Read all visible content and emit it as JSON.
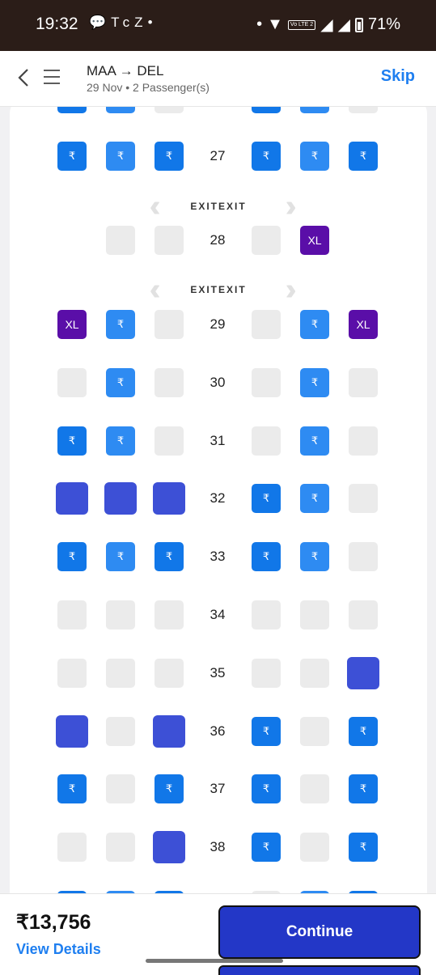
{
  "status": {
    "time": "19:32",
    "left_icons": [
      "chat-icon",
      "teams-icon",
      "c-icon",
      "z-icon",
      "dot"
    ],
    "lte": "Vo LTE 2",
    "battery": "71%"
  },
  "header": {
    "origin": "MAA",
    "arrow": "→",
    "destination": "DEL",
    "subtitle": "29 Nov • 2 Passenger(s)",
    "skip_label": "Skip"
  },
  "exit": {
    "label": "EXITEXIT"
  },
  "seat_symbols": {
    "paid": "₹",
    "xl": "XL"
  },
  "rows": [
    {
      "num": "",
      "seats": [
        "paid",
        "paid-alt",
        "empty",
        "paid",
        "paid-alt",
        "empty"
      ]
    },
    {
      "num": "27",
      "seats": [
        "paid",
        "paid-alt",
        "paid",
        "paid",
        "paid-alt",
        "paid"
      ]
    },
    {
      "num": "28",
      "seats": [
        "none",
        "empty",
        "empty",
        "empty",
        "xl",
        "none"
      ]
    },
    {
      "num": "29",
      "seats": [
        "xl",
        "paid-alt",
        "empty",
        "empty",
        "paid-alt",
        "xl"
      ]
    },
    {
      "num": "30",
      "seats": [
        "empty",
        "paid-alt",
        "empty",
        "empty",
        "paid-alt",
        "empty"
      ]
    },
    {
      "num": "31",
      "seats": [
        "paid",
        "paid-alt",
        "empty",
        "empty",
        "paid-alt",
        "empty"
      ]
    },
    {
      "num": "32",
      "seats": [
        "occupied",
        "occupied",
        "occupied",
        "paid",
        "paid-alt",
        "empty"
      ]
    },
    {
      "num": "33",
      "seats": [
        "paid",
        "paid-alt",
        "paid",
        "paid",
        "paid-alt",
        "empty"
      ]
    },
    {
      "num": "34",
      "seats": [
        "empty",
        "empty",
        "empty",
        "empty",
        "empty",
        "empty"
      ]
    },
    {
      "num": "35",
      "seats": [
        "empty",
        "empty",
        "empty",
        "empty",
        "empty",
        "occupied"
      ]
    },
    {
      "num": "36",
      "seats": [
        "occupied",
        "empty",
        "occupied",
        "paid",
        "empty",
        "paid"
      ]
    },
    {
      "num": "37",
      "seats": [
        "paid",
        "empty",
        "paid",
        "paid",
        "empty",
        "paid"
      ]
    },
    {
      "num": "38",
      "seats": [
        "empty",
        "empty",
        "occupied",
        "paid",
        "empty",
        "paid"
      ]
    },
    {
      "num": "",
      "seats": [
        "paid",
        "paid-alt",
        "paid",
        "empty",
        "paid-alt",
        "paid"
      ]
    }
  ],
  "footer": {
    "price": "₹13,756",
    "details_label": "View Details",
    "continue_label": "Continue"
  }
}
